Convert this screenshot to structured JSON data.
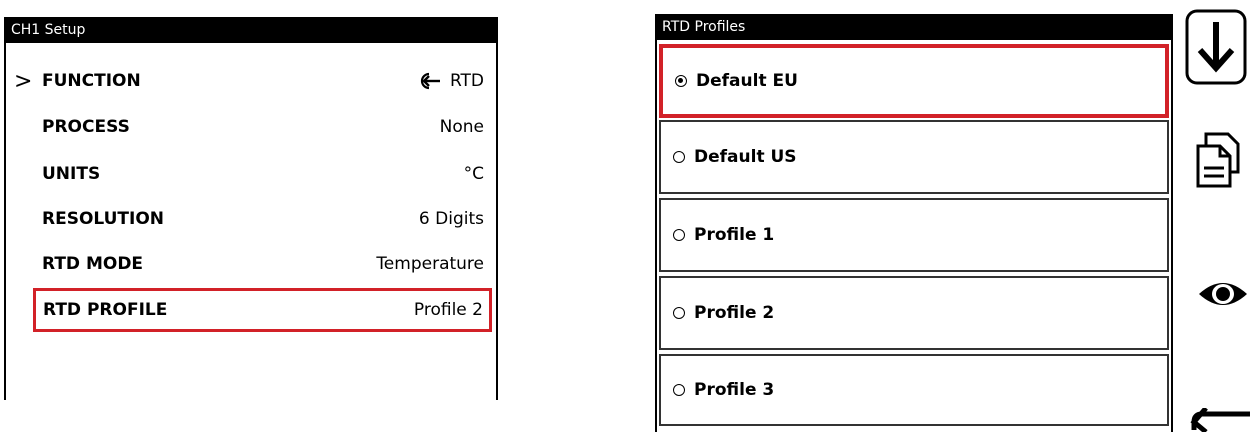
{
  "left": {
    "title": "CH1 Setup",
    "rows": [
      {
        "label": "FUNCTION",
        "value": "RTD",
        "icon": "input-arrow-icon",
        "current": true
      },
      {
        "label": "PROCESS",
        "value": "None"
      },
      {
        "label": "UNITS",
        "value": "°C"
      },
      {
        "label": "RESOLUTION",
        "value": "6 Digits"
      },
      {
        "label": "RTD MODE",
        "value": "Temperature"
      },
      {
        "label": "RTD PROFILE",
        "value": "Profile 2",
        "selected": true
      }
    ]
  },
  "right": {
    "title": "RTD Profiles",
    "profiles": [
      {
        "label": "Default EU",
        "checked": true
      },
      {
        "label": "Default US",
        "checked": false
      },
      {
        "label": "Profile 1",
        "checked": false
      },
      {
        "label": "Profile 2",
        "checked": false
      },
      {
        "label": "Profile 3",
        "checked": false
      }
    ]
  },
  "sidebar": {
    "icons": [
      "download-arrow-icon",
      "copy-document-icon",
      "eye-icon",
      "back-arrow-icon"
    ]
  },
  "colors": {
    "highlight": "#d22128",
    "titlebar": "#000000"
  }
}
